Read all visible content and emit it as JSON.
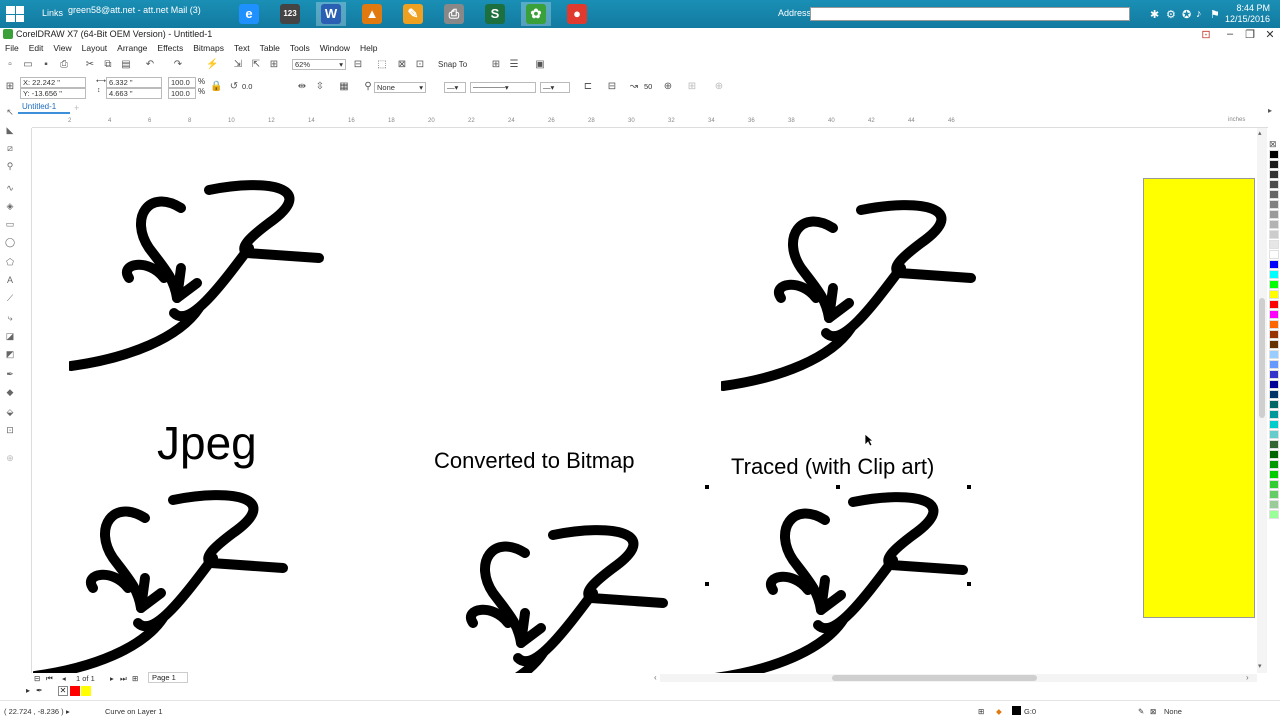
{
  "taskbar": {
    "links_label": "Links",
    "mail_label": "green58@att.net - att.net Mail (3)",
    "address_label": "Address",
    "clock_time": "8:44 PM",
    "clock_date": "12/15/2016",
    "apps": [
      {
        "name": "edge-icon",
        "glyph": "e",
        "color": "#1e90ff",
        "active": false
      },
      {
        "name": "calculator-icon",
        "glyph": "123",
        "color": "#444444",
        "active": false
      },
      {
        "name": "word-icon",
        "glyph": "W",
        "color": "#2b5fb4",
        "active": true
      },
      {
        "name": "coreldraw-balloon-icon",
        "glyph": "▲",
        "color": "#e07a10",
        "active": false
      },
      {
        "name": "pen-app-icon",
        "glyph": "✎",
        "color": "#f0a020",
        "active": false
      },
      {
        "name": "printer-app-icon",
        "glyph": "⎙",
        "color": "#888888",
        "active": false
      },
      {
        "name": "snagit-icon",
        "glyph": "S",
        "color": "#1c6f3f",
        "active": false
      },
      {
        "name": "coreldraw-x7-icon",
        "glyph": "✿",
        "color": "#3aa03a",
        "active": true
      },
      {
        "name": "chrome-icon",
        "glyph": "●",
        "color": "#e03a2e",
        "active": false
      }
    ]
  },
  "window": {
    "title": "CorelDRAW X7 (64-Bit OEM Version) - Untitled-1"
  },
  "menu": [
    "File",
    "Edit",
    "View",
    "Layout",
    "Arrange",
    "Effects",
    "Bitmaps",
    "Text",
    "Table",
    "Tools",
    "Window",
    "Help"
  ],
  "standard_toolbar": {
    "zoom": "62%",
    "snap_to": "Snap To"
  },
  "property_bar": {
    "x": "X: 22.242 \"",
    "y": "Y: -13.656 \"",
    "width": "6.332 \"",
    "height": "4.663 \"",
    "scale_w": "100.0",
    "scale_h": "100.0",
    "pct": "%",
    "rotation": "0.0",
    "wrap": "None",
    "outline_width": "50"
  },
  "document_tab": "Untitled-1",
  "ruler": {
    "units": "inches",
    "numbers": [
      "2",
      "4",
      "6",
      "8",
      "10",
      "12",
      "14",
      "16",
      "18",
      "20",
      "22",
      "24",
      "26",
      "28",
      "30",
      "32",
      "34",
      "36",
      "38",
      "40",
      "42",
      "44",
      "46"
    ]
  },
  "canvas": {
    "captions": {
      "jpeg": "Jpeg",
      "bitmap": "Converted to Bitmap",
      "traced": "Traced (with Clip art)"
    }
  },
  "page_nav": {
    "page_count": "1 of 1",
    "page_tab": "Page 1"
  },
  "palette_colors": [
    "#000000",
    "#1a1a1a",
    "#333333",
    "#4d4d4d",
    "#666666",
    "#808080",
    "#999999",
    "#b3b3b3",
    "#cccccc",
    "#e6e6e6",
    "#ffffff",
    "#0000ff",
    "#00ffff",
    "#00ff00",
    "#ffff00",
    "#ff0000",
    "#ff00ff",
    "#ff6600",
    "#993300",
    "#663300",
    "#99ccff",
    "#6699ff",
    "#3333cc",
    "#000099",
    "#003366",
    "#006666",
    "#009999",
    "#00cccc",
    "#66cccc",
    "#336633",
    "#006600",
    "#009900",
    "#00cc00",
    "#33cc33",
    "#66cc66",
    "#99cc99",
    "#99ff99"
  ],
  "doc_palette": [
    "#ff0000",
    "#ffff00"
  ],
  "status": {
    "coordinates": "( 22.724 , -8.236 )",
    "object_info": "Curve on Layer 1",
    "fill_info": "G:0",
    "outline_info": "None"
  }
}
